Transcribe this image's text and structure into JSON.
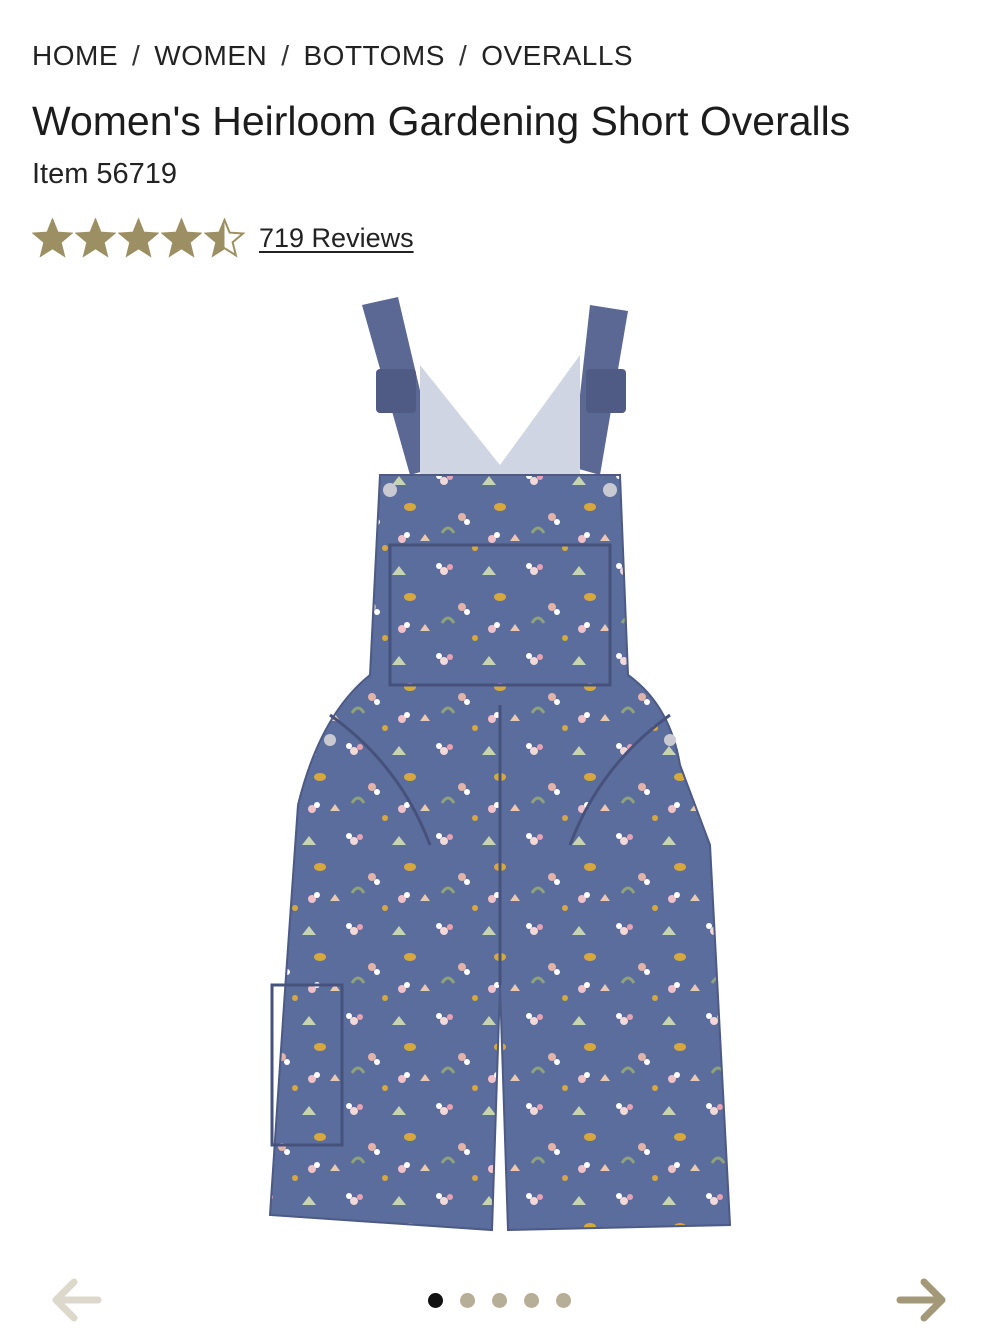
{
  "breadcrumb": {
    "items": [
      "HOME",
      "WOMEN",
      "BOTTOMS",
      "OVERALLS"
    ],
    "separator": "/"
  },
  "product": {
    "title": "Women's Heirloom Gardening Short Overalls",
    "item_label": "Item",
    "item_number": "56719"
  },
  "rating": {
    "value": 4.5,
    "max": 5,
    "reviews_text": "719 Reviews",
    "star_color": "#9c8f63"
  },
  "image": {
    "icon": "overalls-product-image",
    "fabric_color": "#5b6d9c",
    "strap_color": "#5c6894"
  },
  "carousel": {
    "prev_icon": "arrow-left-icon",
    "next_icon": "arrow-right-icon",
    "prev_color": "#ddd8cc",
    "next_color": "#a39978",
    "dot_count": 5,
    "active_index": 0
  }
}
